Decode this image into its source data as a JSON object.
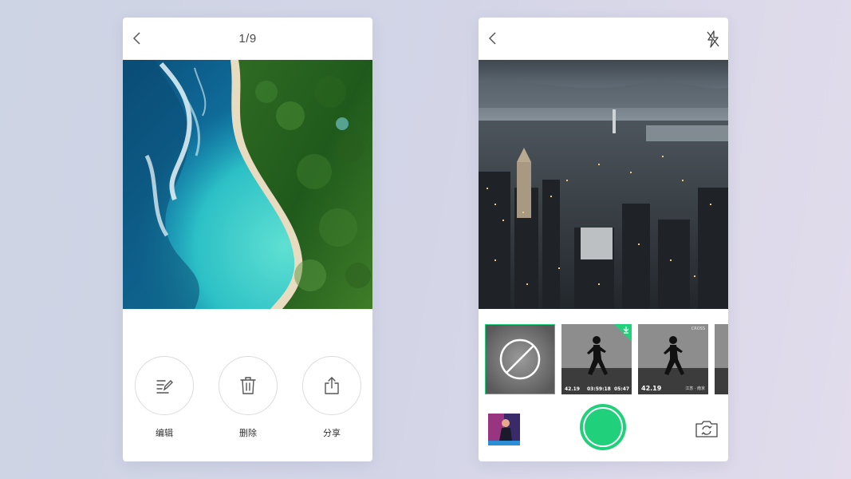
{
  "viewer": {
    "counter": "1/9",
    "actions": [
      {
        "id": "edit",
        "label": "编辑",
        "icon": "edit-icon"
      },
      {
        "id": "delete",
        "label": "删除",
        "icon": "trash-icon"
      },
      {
        "id": "share",
        "label": "分享",
        "icon": "share-icon"
      }
    ]
  },
  "camera": {
    "filters": [
      {
        "id": "none",
        "icon": "no-filter-icon",
        "selected": true
      },
      {
        "id": "filter-1",
        "texts": [
          "42.19",
          "03:59:18",
          "05:47"
        ],
        "badge": "download-icon"
      },
      {
        "id": "filter-2",
        "texts": [
          "42.19",
          "江苏 · 南京"
        ],
        "corner_text": "CROSS"
      },
      {
        "id": "filter-3"
      }
    ],
    "shutter_icon": "shutter-button",
    "switch_icon": "camera-switch-icon",
    "flash_icon": "flash-off-icon"
  },
  "colors": {
    "accent": "#21d07a",
    "background": "#d3d5e7"
  }
}
